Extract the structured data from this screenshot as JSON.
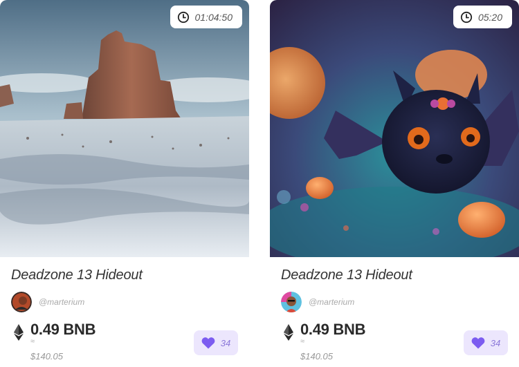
{
  "colors": {
    "accent": "#7c5cf0",
    "like_bg": "#ece6fd",
    "text": "#2a2a2a",
    "muted": "#aaaaaa"
  },
  "cards": [
    {
      "image_desc": "desert-mesa-artwork",
      "timer": "01:04:50",
      "title": "Deadzone 13 Hideout",
      "creator": "@marterium",
      "price": "0.49 BNB",
      "approx": "≈",
      "usd": "$140.05",
      "likes": "34"
    },
    {
      "image_desc": "halloween-bat-artwork",
      "timer": "05:20",
      "title": "Deadzone 13 Hideout",
      "creator": "@marterium",
      "price": "0.49 BNB",
      "approx": "≈",
      "usd": "$140.05",
      "likes": "34"
    }
  ],
  "icons": {
    "timer": "clock-icon",
    "currency": "ethereum-icon",
    "like": "heart-icon"
  }
}
